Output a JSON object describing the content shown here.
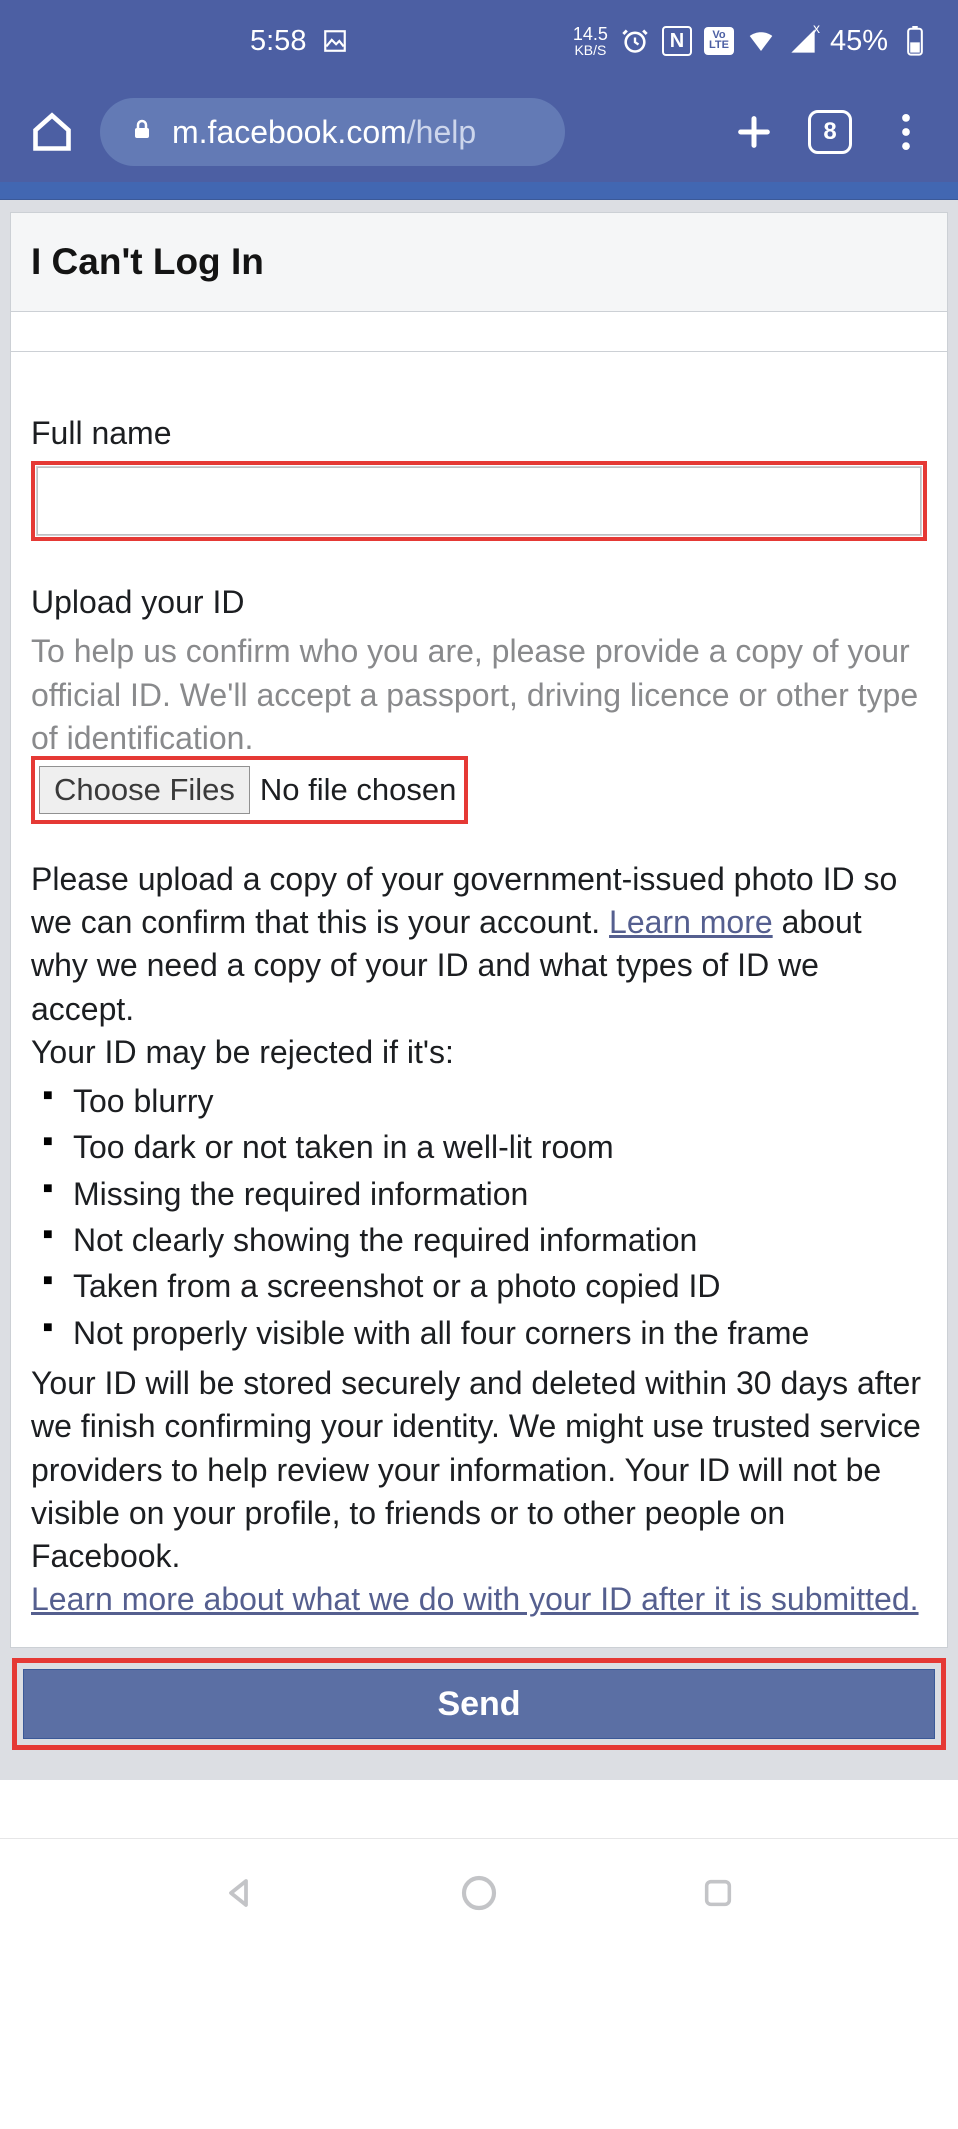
{
  "status": {
    "time": "5:58",
    "net_speed": "14.5",
    "net_unit": "KB/S",
    "lte_chip": "Vo\nLTE",
    "battery_pct": "45%"
  },
  "browser": {
    "url_host": "m.facebook.com",
    "url_path": "/help",
    "tab_count": "8"
  },
  "page": {
    "title": "I Can't Log In",
    "full_name_label": "Full name",
    "full_name_value": "",
    "upload_label": "Upload your ID",
    "upload_desc": "To help us confirm who you are, please provide a copy of your official ID. We'll accept a passport, driving licence or other type of identification.",
    "choose_files_btn": "Choose Files",
    "no_file_text": "No file chosen",
    "p1a": "Please upload a copy of your government-issued photo ID so we can confirm that this is your account. ",
    "p1_link": "Learn more",
    "p1b": " about why we need a copy of your ID and what types of ID we accept.",
    "p_reject_intro": "Your ID may be rejected if it's:",
    "reject_items": [
      "Too blurry",
      "Too dark or not taken in a well-lit room",
      "Missing the required information",
      "Not clearly showing the required information",
      "Taken from a screenshot or a photo copied ID",
      "Not properly visible with all four corners in the frame"
    ],
    "p3": "Your ID will be stored securely and deleted within 30 days after we finish confirming your identity. We might use trusted service providers to help review your information. Your ID will not be visible on your profile, to friends or to other people on Facebook.",
    "p4_link": "Learn more about what we do with your ID after it is submitted.",
    "send_btn": "Send"
  }
}
